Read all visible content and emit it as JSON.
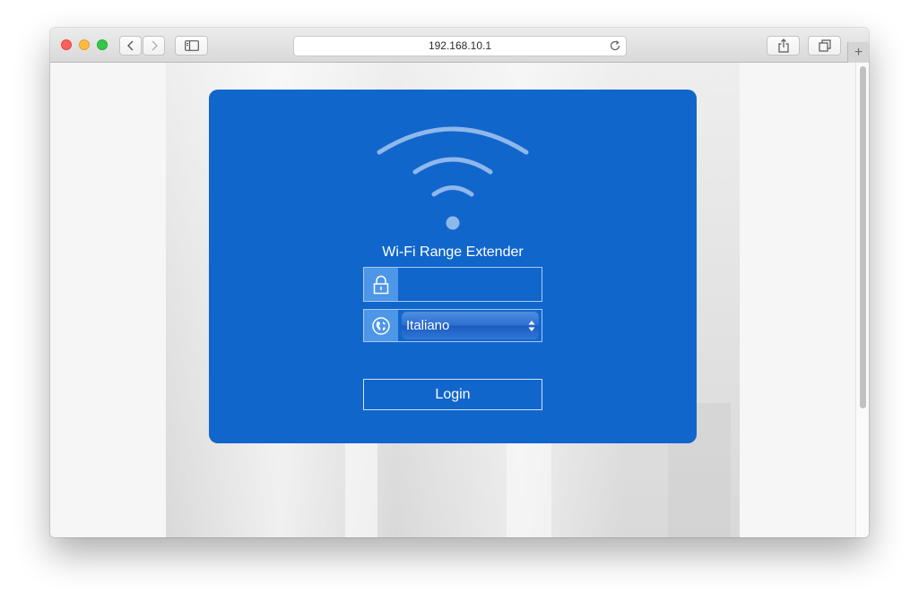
{
  "browser": {
    "address": "192.168.10.1",
    "new_tab_glyph": "+"
  },
  "page": {
    "product_name": "Wi-Fi Range Extender",
    "password": {
      "value": "",
      "placeholder": ""
    },
    "language": {
      "selected": "Italiano"
    },
    "login_label": "Login",
    "icons": [
      "wifi-logo-icon",
      "lock-icon",
      "globe-icon",
      "select-arrows-icon"
    ]
  },
  "colors": {
    "panel": "#1166cc",
    "field_icon_bg": "#4d96e8",
    "wifi_logo": "#8fb8ea"
  }
}
